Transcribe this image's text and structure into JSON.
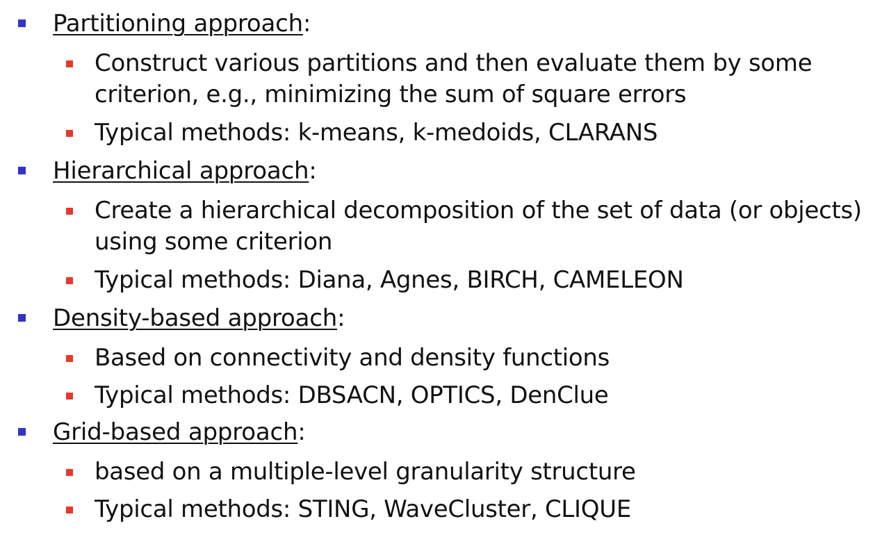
{
  "sections": [
    {
      "heading": "Partitioning approach",
      "suffix": ":",
      "items": [
        "Construct various partitions and then evaluate them by some criterion, e.g., minimizing the sum of square errors",
        "Typical methods: k-means, k-medoids, CLARANS"
      ]
    },
    {
      "heading": "Hierarchical approach",
      "suffix": ":",
      "items": [
        "Create a hierarchical decomposition of the set of data (or objects) using some criterion",
        "Typical methods: Diana, Agnes, BIRCH, CAMELEON"
      ]
    },
    {
      "heading": "Density-based approach",
      "suffix": ":",
      "items": [
        "Based on connectivity and density functions",
        "Typical methods: DBSACN, OPTICS, DenClue"
      ]
    },
    {
      "heading": "Grid-based approach",
      "suffix": ":",
      "items": [
        "based on a multiple-level granularity structure",
        "Typical methods: STING, WaveCluster, CLIQUE"
      ]
    }
  ]
}
